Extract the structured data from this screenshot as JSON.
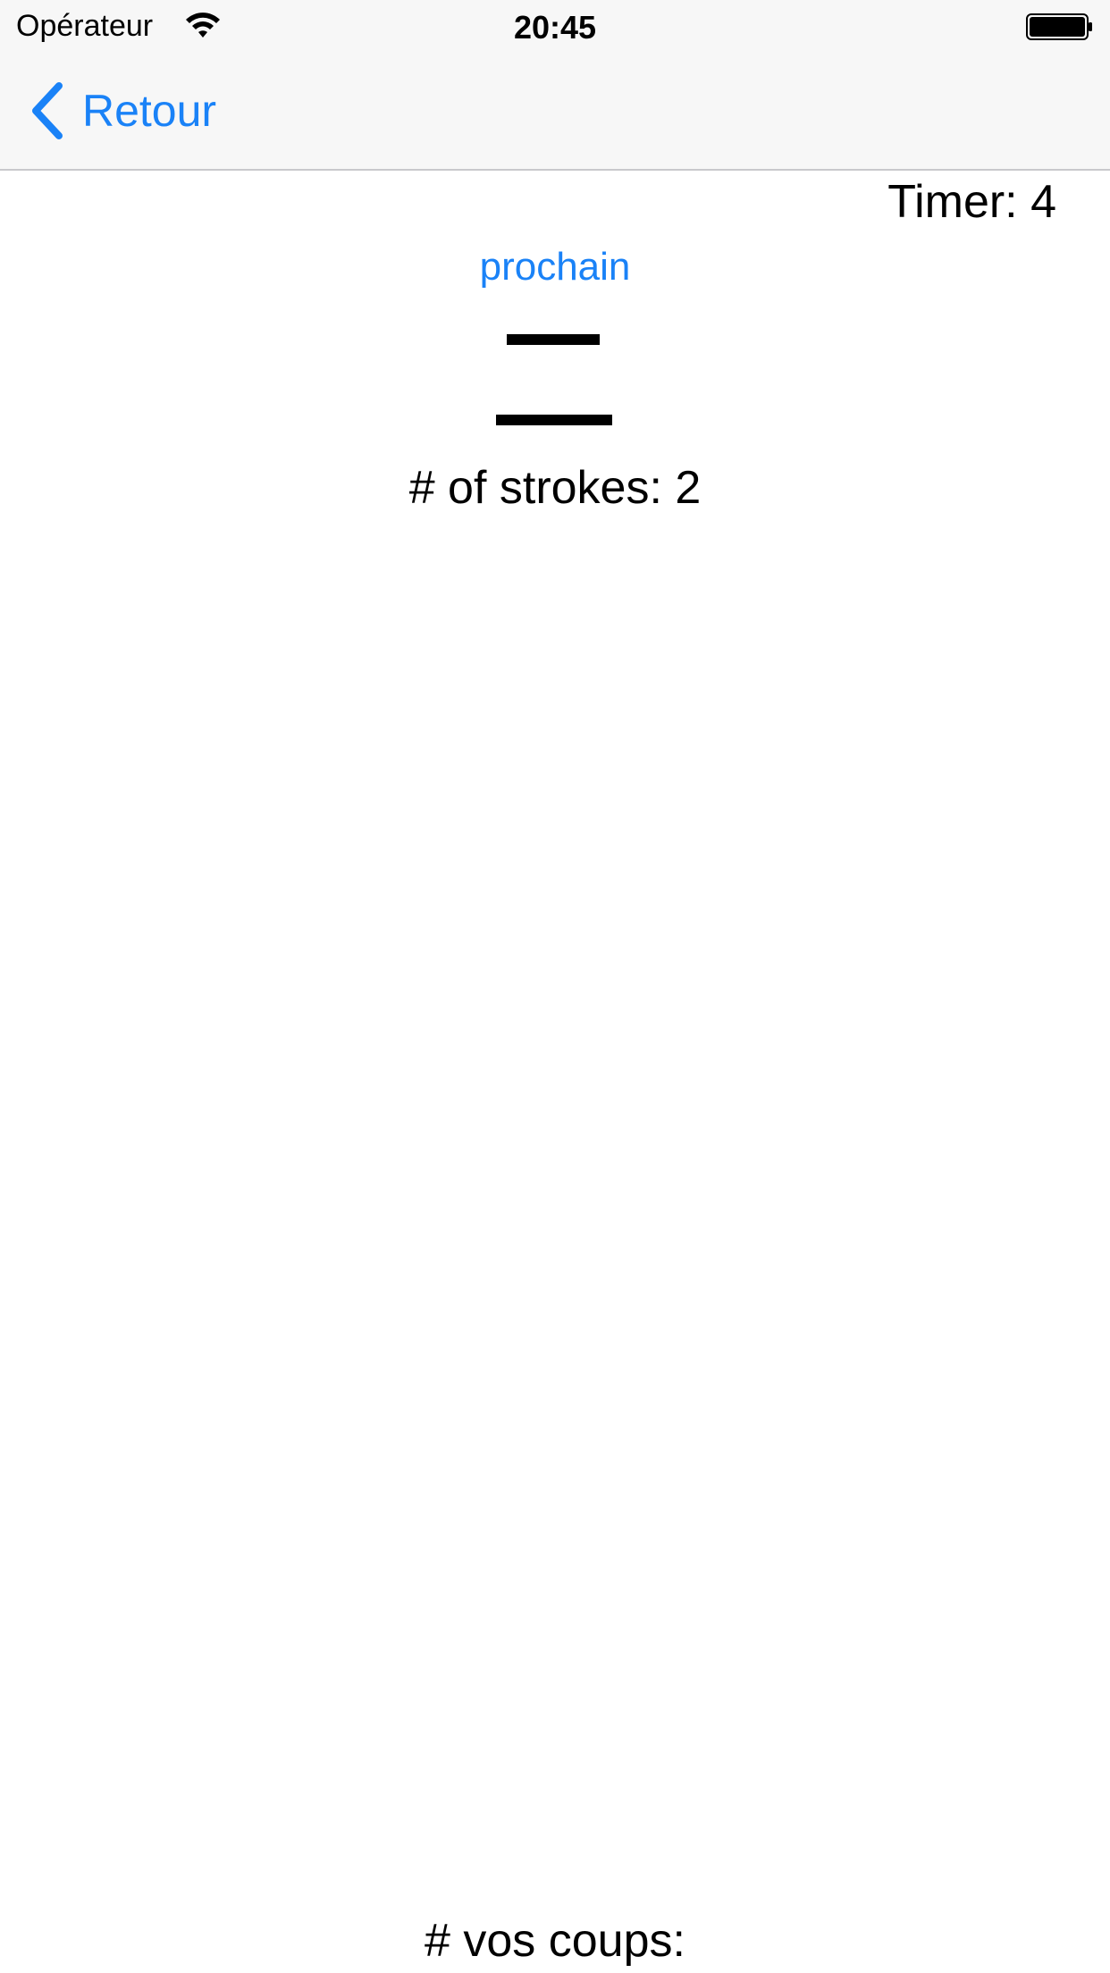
{
  "status_bar": {
    "carrier": "Opérateur",
    "time": "20:45",
    "wifi_icon": "wifi-icon",
    "battery_icon": "battery-icon"
  },
  "nav": {
    "back_label": "Retour",
    "back_icon": "chevron-left-icon"
  },
  "content": {
    "timer": "Timer: 4",
    "next_label": "prochain",
    "character": "二",
    "strokes_label": "# of strokes: 2",
    "your_strokes_label": "# vos coups:"
  },
  "colors": {
    "accent": "#1a82f7",
    "bar_background": "#f7f7f7",
    "separator": "#c8c8cc",
    "text": "#000000"
  }
}
